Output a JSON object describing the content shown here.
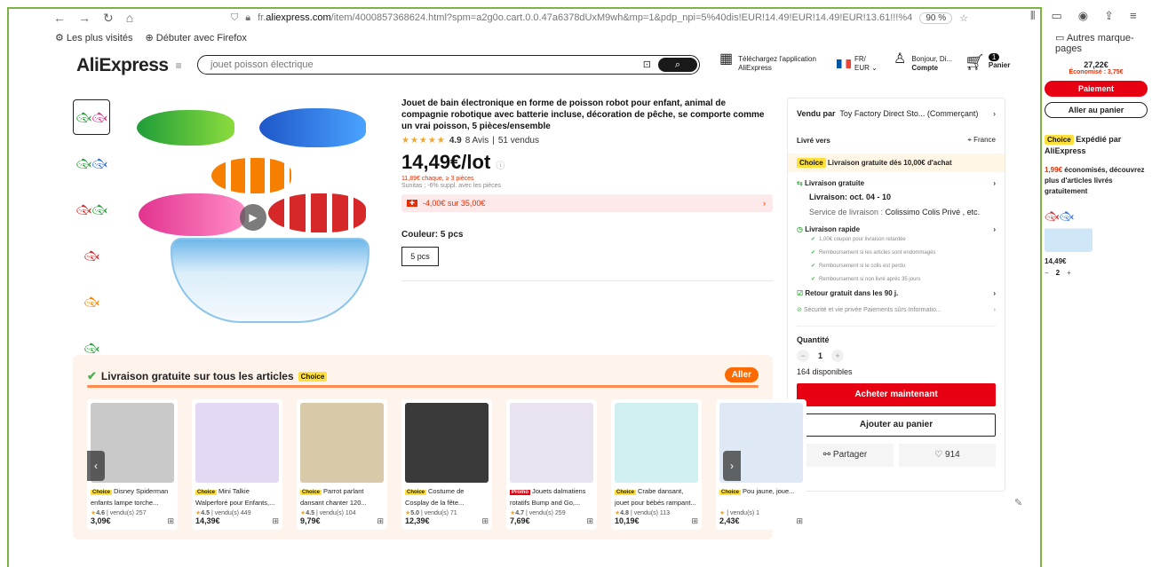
{
  "browser": {
    "back": "←",
    "forward": "→",
    "reload": "↻",
    "home": "⌂",
    "url_prefix": "fr.",
    "url_domain": "aliexpress.com",
    "url_path": "/item/4000857368624.html?spm=a2g0o.cart.0.0.47a6378dUxM9wh&mp=1&pdp_npi=5%40dis!EUR!14.49!EUR!14.49!EUR!13.61!!!%402",
    "zoom": "90 %",
    "bookmarks": [
      "Les plus visités",
      "Débuter avec Firefox"
    ],
    "other_bookmarks": "Autres marque-pages"
  },
  "header": {
    "logo": "AliExpress",
    "search_placeholder": "jouet poisson électrique",
    "app_line1": "Téléchargez l'application",
    "app_line2": "AliExpress",
    "lang_line1": "FR/",
    "lang_line2": "EUR",
    "account_line1": "Bonjour, Di...",
    "account_line2": "Compte",
    "cart_count": "1",
    "cart_label": "Panier"
  },
  "product": {
    "title": "Jouet de bain électronique en forme de poisson robot pour enfant, animal de compagnie robotique avec batterie incluse, décoration de pêche, se comporte comme un vrai poisson, 5 pièces/ensemble",
    "rating": "4.9",
    "reviews": "8 Avis",
    "sold": "51 vendus",
    "price": "14,49€/lot",
    "unit_price": "11,89€ chaque, ≥ 3 pièces",
    "extra": "Sunitas ; -6% suppl. avec les pièces",
    "coupon": "-4,00€ sur 35,00€",
    "color_label": "Couleur: 5 pcs",
    "option": "5 pcs"
  },
  "side": {
    "sold_by_label": "Vendu par",
    "seller": "Toy Factory Direct Sto... (Commerçant)",
    "ship_to_label": "Livré vers",
    "country": "France",
    "choice_tag": "Choice",
    "choice_text": "Livraison gratuite dès 10,00€ d'achat",
    "free_shipping": "Livraison gratuite",
    "delivery": "Livraison: oct. 04 - 10",
    "service": "Service de livraison :",
    "service_names": "Colissimo  Colis Privé , etc.",
    "fast": "Livraison rapide",
    "bullets": [
      "1,00€ coupon pour livraison retardée",
      "Remboursement si les articles sont endommagés",
      "Remboursement si le colis est perdu",
      "Remboursement si non livré après 35 jours"
    ],
    "returns": "Retour gratuit dans les 90 j.",
    "security": "Sécurité et vie privée",
    "security_sub": "Paiements sûrs·Informatio...",
    "qty_label": "Quantité",
    "qty": "1",
    "available": "164 disponibles",
    "buy": "Acheter maintenant",
    "add": "Ajouter au panier",
    "share": "Partager",
    "wish": "914"
  },
  "choice_section": {
    "title": "Livraison gratuite sur tous les articles",
    "tag": "Choice",
    "aller": "Aller",
    "cards": [
      {
        "tag": "Choice",
        "title": "Disney Spiderman enfants lampe torche...",
        "rating": "4.6",
        "sold": "vendu(s) 257",
        "price": "3,09€",
        "color": "#c9c9c9"
      },
      {
        "tag": "Choice",
        "title": "Mini Talkie Walperforé pour Enfants,...",
        "rating": "4.5",
        "sold": "vendu(s) 449",
        "price": "14,39€",
        "color": "#e4d9f5"
      },
      {
        "tag": "Choice",
        "title": "Parrot parlant dansant chanter 120...",
        "rating": "4.5",
        "sold": "vendu(s) 104",
        "price": "9,79€",
        "color": "#d8c9a8"
      },
      {
        "tag": "Choice",
        "title": "Costume de Cosplay de la fête...",
        "rating": "5.0",
        "sold": "vendu(s) 71",
        "price": "12,39€",
        "color": "#3a3a3a"
      },
      {
        "tag": "Promo",
        "title": "Jouets dalmatiens rotatifs Bump and Go,...",
        "rating": "4.7",
        "sold": "vendu(s) 259",
        "price": "7,69€",
        "color": "#e9e2ef"
      },
      {
        "tag": "Choice",
        "title": "Crabe dansant, jouet pour bébés rampant...",
        "rating": "4.8",
        "sold": "vendu(s) 113",
        "price": "10,19€",
        "color": "#cfeff0"
      },
      {
        "tag": "Choice",
        "title": "Pou jaune, joue...",
        "rating": "",
        "sold": "vendu(s) 1",
        "price": "2,43€",
        "color": "#dfe9f5"
      }
    ]
  },
  "cartpanel": {
    "total": "27,22€",
    "saved": "Économisé : 3,75€",
    "pay": "Paiement",
    "go_cart": "Aller au panier",
    "ship_tag": "Choice",
    "ship": "Expédié par AliExpress",
    "promo_red": "1,99€",
    "promo_rest": "économisés, découvrez plus d'articles livrés gratuitement",
    "item_price": "14,49€",
    "item_qty": "2"
  }
}
